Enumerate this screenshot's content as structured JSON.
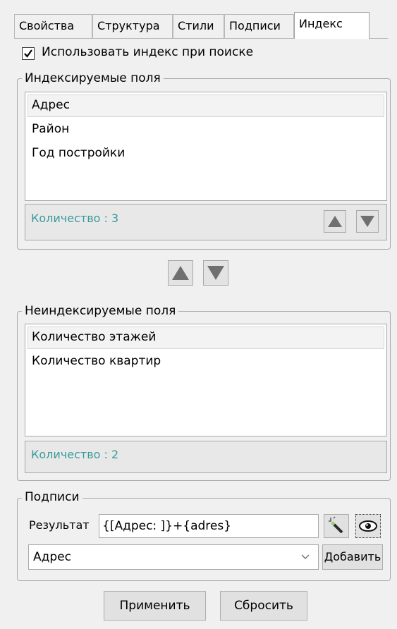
{
  "tabs": [
    "Свойства",
    "Структура",
    "Стили",
    "Подписи",
    "Индекс"
  ],
  "active_tab": "Индекс",
  "use_index": {
    "label": "Использовать индекс при поиске",
    "checked": true
  },
  "indexed": {
    "title": "Индексируемые поля",
    "items": [
      "Адрес",
      "Район",
      "Год постройки"
    ],
    "count_label": "Количество :  3"
  },
  "not_indexed": {
    "title": "Неиндексируемые поля",
    "items": [
      "Количество этажей",
      "Количество квартир"
    ],
    "count_label": "Количество :  2"
  },
  "captions": {
    "title": "Подписи",
    "result_label": "Результат",
    "result_value": "{[Адрес: ]}+{adres}",
    "field_value": "Адрес",
    "add_label": "Добавить"
  },
  "footer": {
    "apply_label": "Применить",
    "reset_label": "Сбросить"
  },
  "colors": {
    "count_text": "#3a9a9a",
    "arrow": "#6f6f6f"
  }
}
